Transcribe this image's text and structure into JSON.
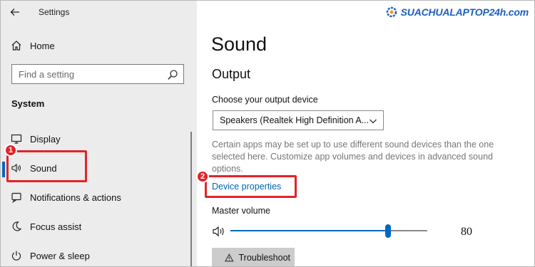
{
  "window": {
    "title": "Settings"
  },
  "sidebar": {
    "home_label": "Home",
    "search_placeholder": "Find a setting",
    "section_heading": "System",
    "items": [
      {
        "label": "Display",
        "icon": "monitor-icon"
      },
      {
        "label": "Sound",
        "icon": "speaker-icon",
        "selected": true
      },
      {
        "label": "Notifications & actions",
        "icon": "notification-icon"
      },
      {
        "label": "Focus assist",
        "icon": "moon-icon"
      },
      {
        "label": "Power & sleep",
        "icon": "power-icon"
      }
    ]
  },
  "main": {
    "page_title": "Sound",
    "output_heading": "Output",
    "device_label": "Choose your output device",
    "device_value": "Speakers (Realtek High Definition A...",
    "description": "Certain apps may be set up to use different sound devices than the one selected here. Customize app volumes and devices in advanced sound options.",
    "device_properties_link": "Device properties",
    "master_volume_label": "Master volume",
    "volume_value": "80",
    "volume_percent": 80,
    "troubleshoot_label": "Troubleshoot"
  },
  "annotations": [
    {
      "number": "1"
    },
    {
      "number": "2"
    }
  ],
  "watermark": {
    "text": "SUACHUALAPTOP24h.com"
  },
  "colors": {
    "accent": "#0067c0",
    "highlight": "#e3232a",
    "link": "#0066b4",
    "sidebar_bg": "#ececec"
  }
}
